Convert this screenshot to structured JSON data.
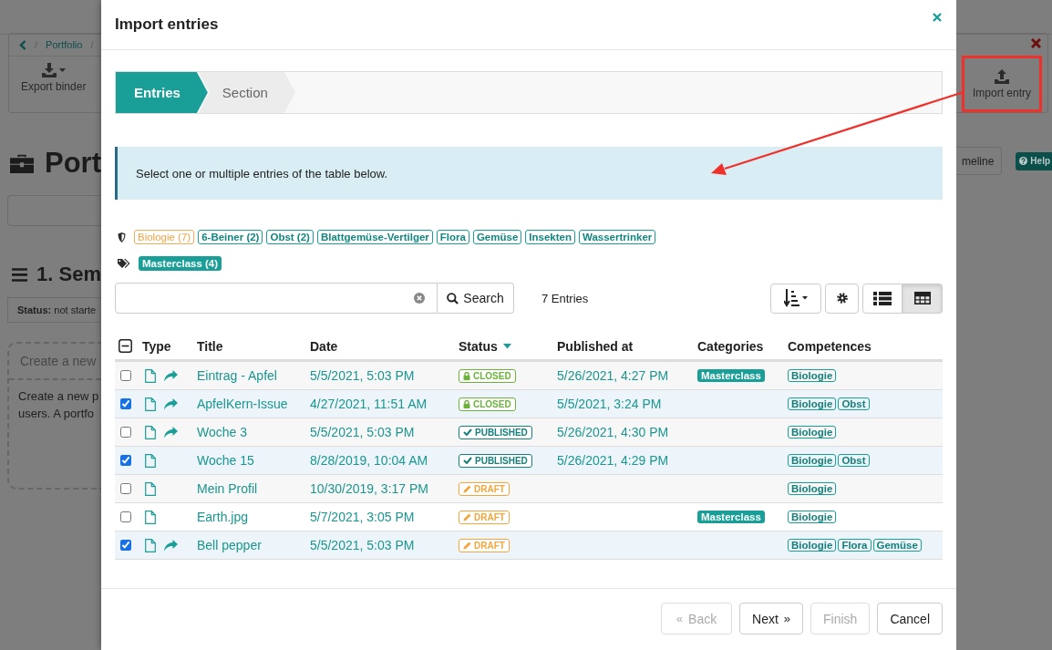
{
  "background": {
    "breadcrumb": {
      "separator": "/",
      "items": [
        "Portfolio"
      ]
    },
    "export_button": "Export binder",
    "page_title": "Port",
    "section_title": "1. Sem",
    "status": "**Status:** not starte",
    "card_title": "Create a new",
    "card_text": [
      "Create a new p",
      "users. A portfo"
    ],
    "import_button": "Import entry",
    "import_highlighted": true,
    "timeline_button": "meline",
    "help_button": "Help"
  },
  "modal": {
    "title": "Import entries",
    "steps": [
      {
        "label": "Entries",
        "selected": true
      },
      {
        "label": "Section",
        "selected": false
      }
    ],
    "info": "Select one or multiple entries of the table below.",
    "competence_filters": [
      {
        "label": "Biologie (7)",
        "selected": true
      },
      {
        "label": "6-Beiner (2)",
        "selected": false
      },
      {
        "label": "Obst (2)",
        "selected": false
      },
      {
        "label": "Blattgemüse-Vertilger",
        "selected": false
      },
      {
        "label": "Flora",
        "selected": false
      },
      {
        "label": "Gemüse",
        "selected": false
      },
      {
        "label": "Insekten",
        "selected": false
      },
      {
        "label": "Wassertrinker",
        "selected": false
      }
    ],
    "tag_filters": [
      "Masterclass (4)"
    ],
    "search": {
      "button": "Search"
    },
    "count": "7 Entries",
    "views": [
      {
        "kind": "list",
        "selected": false
      },
      {
        "kind": "table",
        "selected": true
      }
    ],
    "table": {
      "indeterminate": true,
      "columns": [
        {
          "label": "Type",
          "sorted": false
        },
        {
          "label": "Title",
          "sorted": false
        },
        {
          "label": "Date",
          "sorted": false
        },
        {
          "label": "Status",
          "sorted": true
        },
        {
          "label": "Published at",
          "sorted": false
        },
        {
          "label": "Categories",
          "sorted": false
        },
        {
          "label": "Competences",
          "sorted": false
        }
      ],
      "rows": [
        {
          "checked": false,
          "shared": true,
          "title": "Eintrag - Apfel",
          "date": "5/5/2021, 5:03 PM",
          "status": {
            "kind": "closed",
            "label": "CLOSED"
          },
          "published": "5/26/2021, 4:27 PM",
          "categories": [
            "Masterclass"
          ],
          "competences": [
            "Biologie"
          ]
        },
        {
          "checked": true,
          "shared": true,
          "title": "ApfelKern-Issue",
          "date": "4/27/2021, 11:51 AM",
          "status": {
            "kind": "closed",
            "label": "CLOSED"
          },
          "published": "5/5/2021, 3:24 PM",
          "categories": [],
          "competences": [
            "Biologie",
            "Obst"
          ]
        },
        {
          "checked": false,
          "shared": true,
          "title": "Woche 3",
          "date": "5/5/2021, 5:03 PM",
          "status": {
            "kind": "published",
            "label": "PUBLISHED"
          },
          "published": "5/26/2021, 4:30 PM",
          "categories": [],
          "competences": [
            "Biologie"
          ]
        },
        {
          "checked": true,
          "shared": false,
          "title": "Woche 15",
          "date": "8/28/2019, 10:04 AM",
          "status": {
            "kind": "published",
            "label": "PUBLISHED"
          },
          "published": "5/26/2021, 4:29 PM",
          "categories": [],
          "competences": [
            "Biologie",
            "Obst"
          ]
        },
        {
          "checked": false,
          "shared": false,
          "title": "Mein Profil",
          "date": "10/30/2019, 3:17 PM",
          "status": {
            "kind": "draft",
            "label": "DRAFT"
          },
          "published": "",
          "categories": [],
          "competences": [
            "Biologie"
          ]
        },
        {
          "checked": false,
          "shared": false,
          "title": "Earth.jpg",
          "date": "5/7/2021, 3:05 PM",
          "status": {
            "kind": "draft",
            "label": "DRAFT"
          },
          "published": "",
          "categories": [
            "Masterclass"
          ],
          "competences": [
            "Biologie"
          ]
        },
        {
          "checked": true,
          "shared": true,
          "title": "Bell pepper",
          "date": "5/5/2021, 5:03 PM",
          "status": {
            "kind": "draft",
            "label": "DRAFT"
          },
          "published": "",
          "categories": [],
          "competences": [
            "Biologie",
            "Flora",
            "Gemüse"
          ]
        }
      ]
    },
    "buttons": [
      {
        "kind": "back",
        "label": "Back",
        "glyph": "«",
        "disabled": true
      },
      {
        "kind": "next",
        "label": "Next",
        "glyph": "»",
        "disabled": false
      },
      {
        "kind": "finish",
        "label": "Finish",
        "disabled": true
      },
      {
        "kind": "cancel",
        "label": "Cancel",
        "disabled": false
      }
    ]
  }
}
